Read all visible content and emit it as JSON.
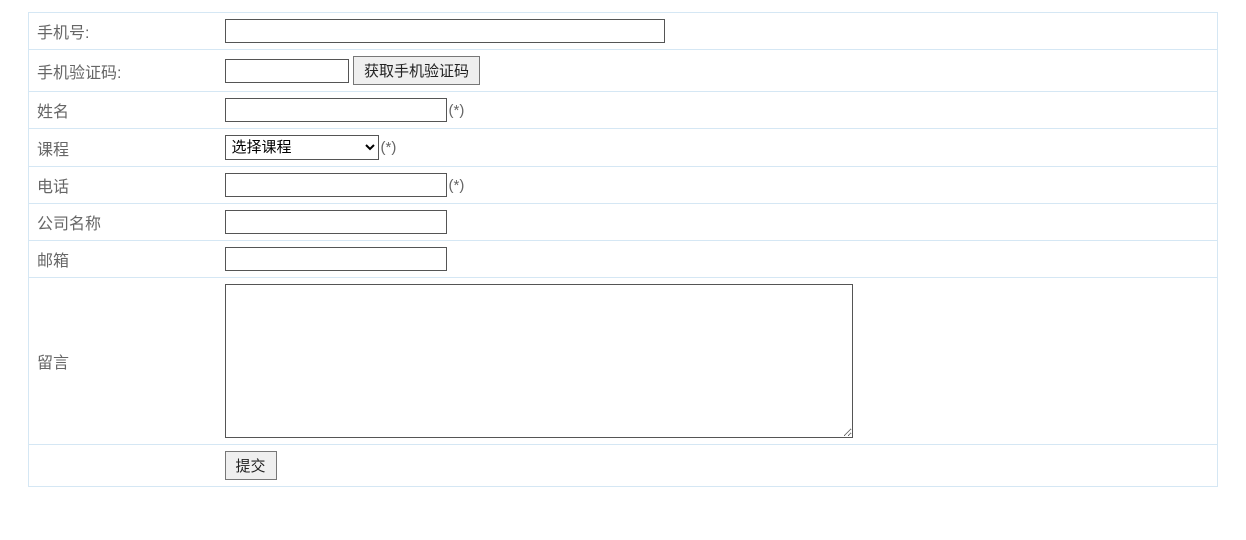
{
  "form": {
    "phone": {
      "label": "手机号:"
    },
    "phoneCode": {
      "label": "手机验证码:",
      "button": "获取手机验证码"
    },
    "name": {
      "label": "姓名",
      "required": "(*)"
    },
    "course": {
      "label": "课程",
      "selectPlaceholder": "选择课程",
      "required": "(*)"
    },
    "tel": {
      "label": "电话",
      "required": "(*)"
    },
    "company": {
      "label": "公司名称"
    },
    "email": {
      "label": "邮箱"
    },
    "message": {
      "label": "留言"
    },
    "submit": {
      "label": "提交"
    }
  }
}
